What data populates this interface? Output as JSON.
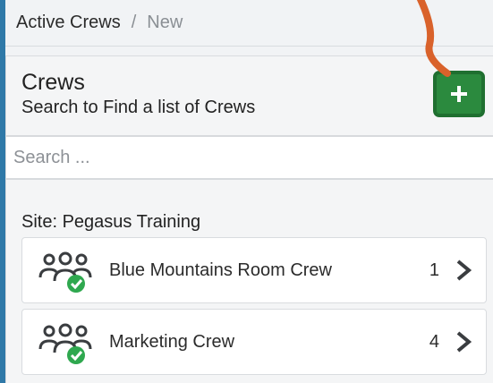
{
  "breadcrumb": {
    "active": "Active Crews",
    "separator": "/",
    "current": "New"
  },
  "panel": {
    "title": "Crews",
    "subtitle": "Search to Find a list of Crews",
    "add_button_icon": "plus-icon"
  },
  "search": {
    "placeholder": "Search ...",
    "value": ""
  },
  "site": {
    "label": "Site: Pegasus Training"
  },
  "crews": [
    {
      "name": "Blue Mountains Room Crew",
      "count": "1",
      "icon": "crew-verified-icon"
    },
    {
      "name": "Marketing Crew",
      "count": "4",
      "icon": "crew-verified-icon"
    }
  ],
  "colors": {
    "accent_blue": "#2f79a8",
    "add_green": "#2b8a3e",
    "check_green": "#2fa84f",
    "annotation_orange": "#d9622b"
  }
}
